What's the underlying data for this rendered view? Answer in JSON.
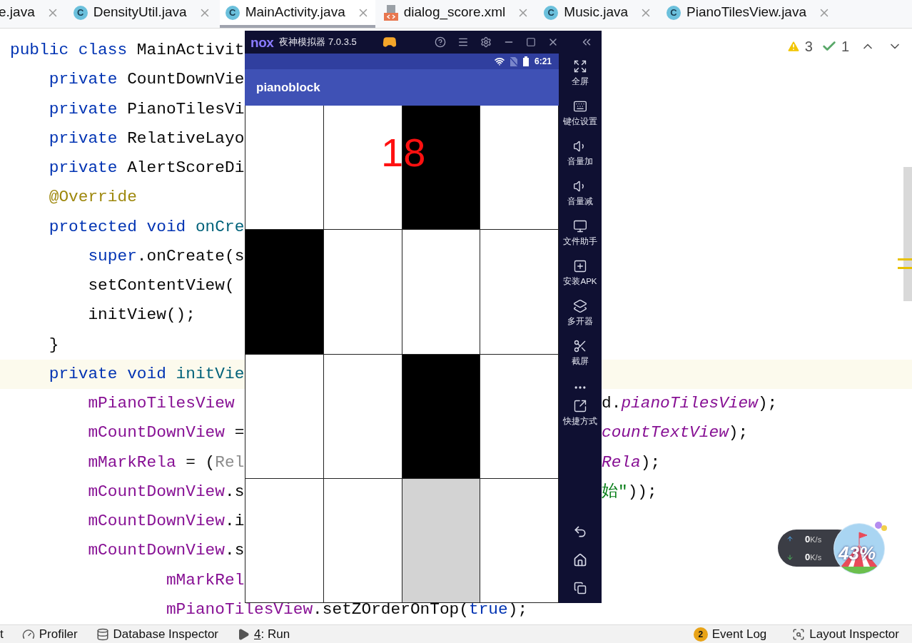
{
  "tabs": [
    {
      "label": "e.java",
      "kind": "java",
      "selected": false
    },
    {
      "label": "DensityUtil.java",
      "icon_letter": "C",
      "kind": "java",
      "selected": false
    },
    {
      "label": "MainActivity.java",
      "icon_letter": "C",
      "kind": "java",
      "selected": true
    },
    {
      "label": "dialog_score.xml",
      "kind": "xml",
      "selected": false
    },
    {
      "label": "Music.java",
      "icon_letter": "C",
      "kind": "java",
      "selected": false
    },
    {
      "label": "PianoTilesView.java",
      "icon_letter": "C",
      "kind": "java",
      "selected": false
    }
  ],
  "inspections": {
    "warnings": "3",
    "weak_warnings": "1"
  },
  "code_lines": [
    {
      "current": false,
      "left": [
        {
          "text": "public class ",
          "kind": "keyword"
        },
        {
          "text": "MainActivit",
          "kind": "plain"
        }
      ]
    },
    {
      "current": false,
      "left": [
        {
          "text": "    private ",
          "kind": "keyword"
        },
        {
          "text": "CountDownVie",
          "kind": "plain"
        }
      ]
    },
    {
      "current": false,
      "left": [
        {
          "text": "    private ",
          "kind": "keyword"
        },
        {
          "text": "PianoTilesVi",
          "kind": "plain"
        }
      ]
    },
    {
      "current": false,
      "left": [
        {
          "text": "    private ",
          "kind": "keyword"
        },
        {
          "text": "RelativeLayo",
          "kind": "plain"
        }
      ]
    },
    {
      "current": false,
      "left": [
        {
          "text": "    private ",
          "kind": "keyword"
        },
        {
          "text": "AlertScoreDi",
          "kind": "plain"
        }
      ]
    },
    {
      "current": false,
      "left": [
        {
          "text": "    @Override",
          "kind": "annotation"
        }
      ]
    },
    {
      "current": false,
      "left": [
        {
          "text": "    protected void ",
          "kind": "keyword"
        },
        {
          "text": "onCre",
          "kind": "method"
        }
      ]
    },
    {
      "current": false,
      "left": [
        {
          "text": "        super",
          "kind": "keyword"
        },
        {
          "text": ".onCreate(s",
          "kind": "plain"
        }
      ]
    },
    {
      "current": false,
      "left": [
        {
          "text": "        setContentView(",
          "kind": "plain"
        }
      ]
    },
    {
      "current": false,
      "left": [
        {
          "text": "        initView();",
          "kind": "plain"
        }
      ]
    },
    {
      "current": false,
      "left": [
        {
          "text": "    }",
          "kind": "plain"
        }
      ]
    },
    {
      "current": true,
      "left": [
        {
          "text": "    private void ",
          "kind": "keyword"
        },
        {
          "text": "initVie",
          "kind": "method"
        }
      ]
    },
    {
      "current": false,
      "left": [
        {
          "text": "        mPianoTilesView",
          "kind": "field"
        }
      ],
      "right": [
        {
          "text": "d.",
          "kind": "plain"
        },
        {
          "text": "pianoTilesView",
          "kind": "static"
        },
        {
          "text": ");",
          "kind": "plain"
        }
      ]
    },
    {
      "current": false,
      "left": [
        {
          "text": "        mCountDownView",
          "kind": "field"
        },
        {
          "text": " =",
          "kind": "plain"
        }
      ],
      "right": [
        {
          "text": "countTextView",
          "kind": "static"
        },
        {
          "text": ");",
          "kind": "plain"
        }
      ]
    },
    {
      "current": false,
      "left": [
        {
          "text": "        mMarkRela",
          "kind": "field"
        },
        {
          "text": " = (",
          "kind": "plain"
        },
        {
          "text": "Rel",
          "kind": "muted"
        }
      ],
      "right": [
        {
          "text": "Rela",
          "kind": "static"
        },
        {
          "text": ");",
          "kind": "plain"
        }
      ]
    },
    {
      "current": false,
      "left": [
        {
          "text": "        mCountDownView",
          "kind": "field"
        },
        {
          "text": ".s",
          "kind": "plain"
        }
      ],
      "right": [
        {
          "text": "始\"",
          "kind": "string"
        },
        {
          "text": "));",
          "kind": "plain"
        }
      ]
    },
    {
      "current": false,
      "left": [
        {
          "text": "        mCountDownView",
          "kind": "field"
        },
        {
          "text": ".i",
          "kind": "plain"
        }
      ]
    },
    {
      "current": false,
      "left": [
        {
          "text": "        mCountDownView",
          "kind": "field"
        },
        {
          "text": ".s",
          "kind": "plain"
        }
      ]
    },
    {
      "current": false,
      "left": [
        {
          "text": "                mMarkRel",
          "kind": "field"
        }
      ]
    },
    {
      "current": false,
      "left": [
        {
          "text": "                mPianoTilesView",
          "kind": "field"
        },
        {
          "text": ".setZOrderOnTop(",
          "kind": "plain"
        },
        {
          "text": "true",
          "kind": "keyword"
        },
        {
          "text": ");",
          "kind": "plain"
        }
      ]
    }
  ],
  "emulator": {
    "logo": "nox",
    "title": "夜神模拟器 7.0.3.5",
    "phone": {
      "time": "6:21",
      "app_title": "pianoblock",
      "score": "18",
      "grid": [
        [
          {
            "kind": "white"
          },
          {
            "kind": "white"
          },
          {
            "kind": "black"
          },
          {
            "kind": "white"
          }
        ],
        [
          {
            "kind": "black"
          },
          {
            "kind": "white"
          },
          {
            "kind": "white"
          },
          {
            "kind": "white"
          }
        ],
        [
          {
            "kind": "white"
          },
          {
            "kind": "white"
          },
          {
            "kind": "black"
          },
          {
            "kind": "white"
          }
        ],
        [
          {
            "kind": "white"
          },
          {
            "kind": "white"
          },
          {
            "kind": "grey"
          },
          {
            "kind": "white"
          }
        ]
      ]
    },
    "sidebar": [
      {
        "label": "全屏",
        "kind": "fullscreen"
      },
      {
        "label": "键位设置",
        "kind": "keyboard"
      },
      {
        "label": "音量加",
        "kind": "volume-up"
      },
      {
        "label": "音量减",
        "kind": "volume-down"
      },
      {
        "label": "文件助手",
        "kind": "monitor"
      },
      {
        "label": "安装APK",
        "kind": "apk"
      },
      {
        "label": "多开器",
        "kind": "multi"
      },
      {
        "label": "截屏",
        "kind": "scissors"
      },
      {
        "label": "快捷方式",
        "kind": "shortcut"
      }
    ]
  },
  "network_widget": {
    "upload": {
      "value": "0",
      "unit": "K/s"
    },
    "download": {
      "value": "0",
      "unit": "K/s"
    },
    "percent": "43%"
  },
  "status_bar": {
    "left": [
      {
        "label": "t",
        "kind": "none"
      },
      {
        "label": "Profiler",
        "kind": "profiler"
      },
      {
        "label": "Database Inspector",
        "kind": "database"
      },
      {
        "label": ": Run",
        "mnemonic": "4",
        "kind": "run"
      }
    ],
    "right": [
      {
        "label": "Event Log",
        "badge": "2",
        "kind": "event"
      },
      {
        "label": "Layout Inspector",
        "kind": "layout"
      }
    ]
  }
}
